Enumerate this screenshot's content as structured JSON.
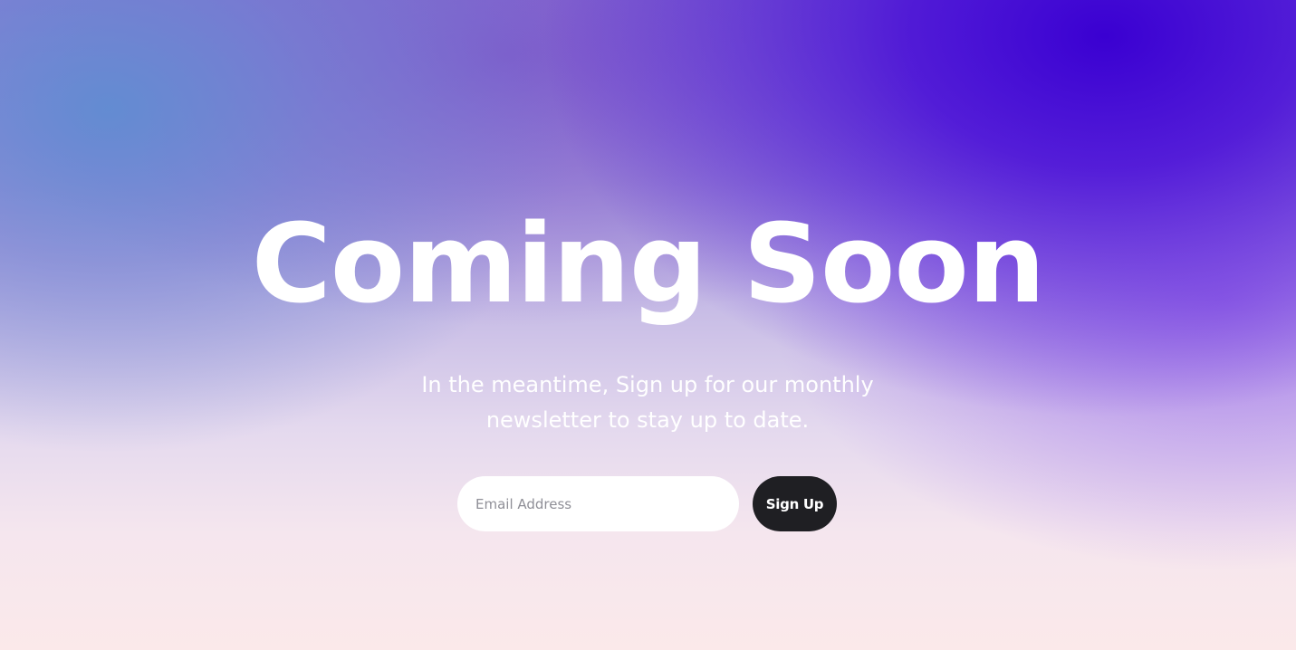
{
  "hero": {
    "title": "Coming Soon",
    "subtitle_line1": "In the meantime, Sign up for our monthly",
    "subtitle_line2": "newsletter to stay up to date."
  },
  "signup_form": {
    "email_placeholder": "Email Address",
    "email_value": "",
    "button_label": "Sign Up"
  },
  "colors": {
    "background_top_right": "#3a00d2",
    "background_top_left": "#6f8fd4",
    "background_bottom": "#fbe9ea",
    "title_text": "#ffffff",
    "button_background": "#1f1f23",
    "button_text": "#ffffff",
    "input_background": "#ffffff"
  }
}
